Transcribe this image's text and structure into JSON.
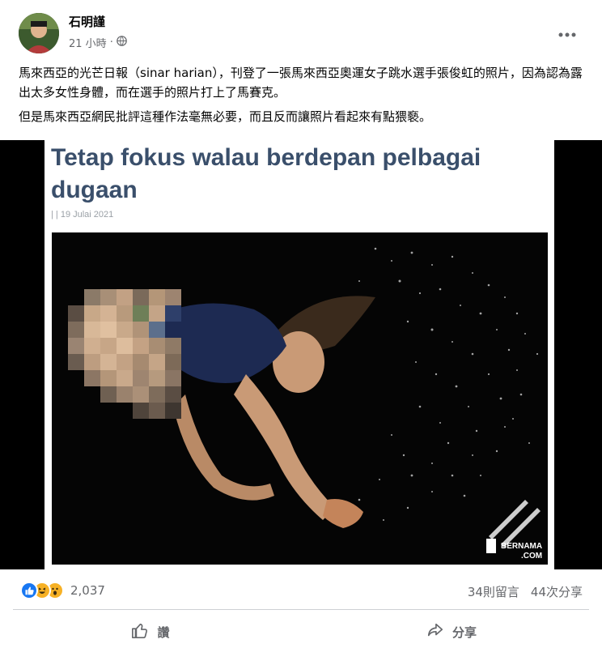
{
  "post": {
    "author": "石明謹",
    "timestamp": "21 小時",
    "separator": "·",
    "privacy_icon": "globe-icon",
    "more_icon": "more-horizontal-icon",
    "paragraphs": [
      "馬來西亞的光芒日報（sinar harian），刊登了一張馬來西亞奧運女子跳水選手張俊虹的照片，因為認為露出太多女性身體，而在選手的照片打上了馬賽克。",
      "但是馬來西亞網民批評這種作法毫無必要，而且反而讓照片看起來有點猥褻。"
    ]
  },
  "article": {
    "headline": "Tetap fokus walau berdepan pelbagai dugaan",
    "dateline": "| | 19 Julai 2021",
    "watermark_line1": "BERNAMA",
    "watermark_line2": ".COM"
  },
  "stats": {
    "reactions": [
      "like-icon",
      "haha-icon",
      "wow-icon"
    ],
    "reaction_count": "2,037",
    "comments": "34則留言",
    "shares": "44次分享"
  },
  "actions": {
    "like_label": "讚",
    "share_label": "分享"
  },
  "colors": {
    "like_blue": "#1877f2",
    "reaction_yellow": "#f7b125",
    "headline_color": "#3a4f6b",
    "secondary_text": "#65676b"
  }
}
